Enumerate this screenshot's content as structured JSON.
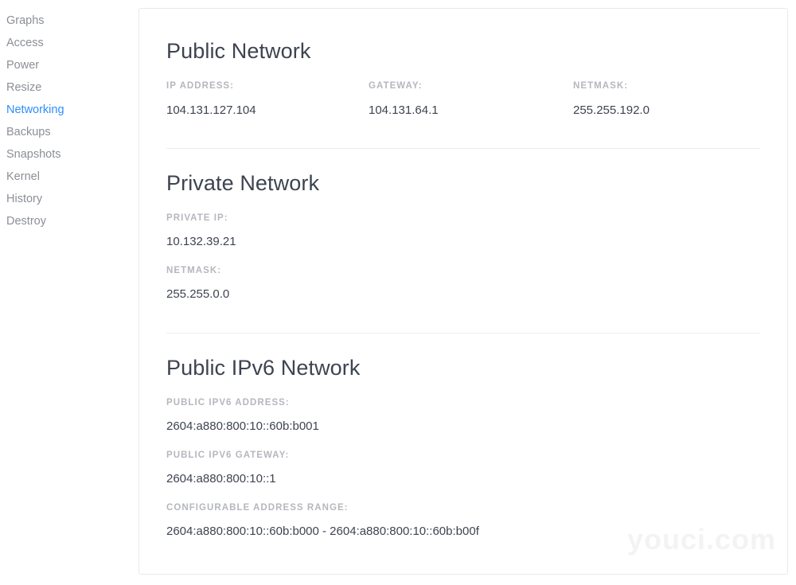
{
  "sidebar": {
    "items": [
      {
        "label": "Graphs",
        "active": false
      },
      {
        "label": "Access",
        "active": false
      },
      {
        "label": "Power",
        "active": false
      },
      {
        "label": "Resize",
        "active": false
      },
      {
        "label": "Networking",
        "active": true
      },
      {
        "label": "Backups",
        "active": false
      },
      {
        "label": "Snapshots",
        "active": false
      },
      {
        "label": "Kernel",
        "active": false
      },
      {
        "label": "History",
        "active": false
      },
      {
        "label": "Destroy",
        "active": false
      }
    ],
    "active_color": "#2e8ef7",
    "inactive_color": "#8b8f96"
  },
  "public_network": {
    "title": "Public Network",
    "ip_address_label": "IP ADDRESS:",
    "ip_address_value": "104.131.127.104",
    "gateway_label": "GATEWAY:",
    "gateway_value": "104.131.64.1",
    "netmask_label": "NETMASK:",
    "netmask_value": "255.255.192.0"
  },
  "private_network": {
    "title": "Private Network",
    "private_ip_label": "PRIVATE IP:",
    "private_ip_value": "10.132.39.21",
    "netmask_label": "NETMASK:",
    "netmask_value": "255.255.0.0"
  },
  "public_ipv6_network": {
    "title": "Public IPv6 Network",
    "address_label": "PUBLIC IPV6 ADDRESS:",
    "address_value": "2604:a880:800:10::60b:b001",
    "gateway_label": "PUBLIC IPV6 GATEWAY:",
    "gateway_value": "2604:a880:800:10::1",
    "range_label": "CONFIGURABLE ADDRESS RANGE:",
    "range_value": "2604:a880:800:10::60b:b000 - 2604:a880:800:10::60b:b00f"
  },
  "watermark": {
    "text": "youci.com"
  }
}
